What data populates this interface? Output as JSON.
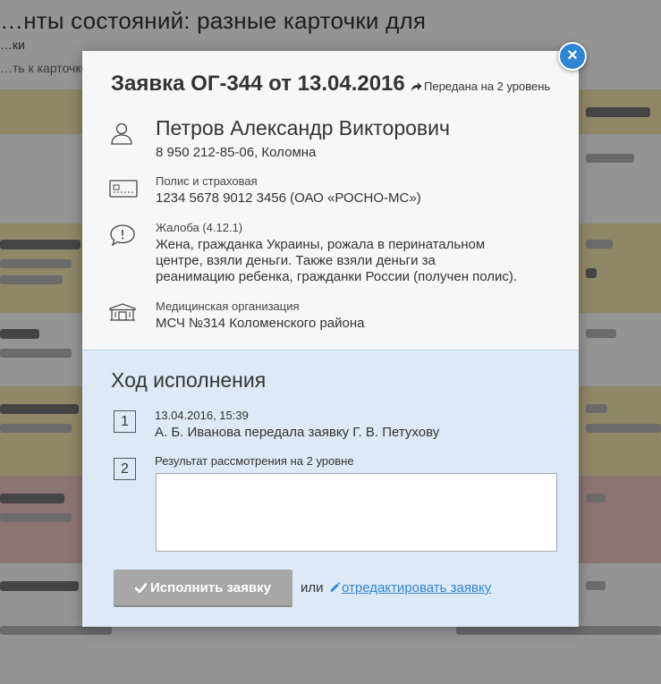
{
  "background": {
    "title": "…нты состояний: разные карточки для",
    "subtitle": "…ки",
    "subtitle2": "…ть к карточке"
  },
  "modal": {
    "close_label": "×",
    "title": "Заявка ОГ-344 от 13.04.2016",
    "status": "Передана на 2 уровень",
    "person": {
      "name": "Петров Александр Викторович",
      "contact": "8 950 212-85-06, Коломна"
    },
    "policy": {
      "label": "Полис и страховая",
      "value": "1234 5678 9012 3456 (ОАО «РОСНО-МС»)"
    },
    "complaint": {
      "label": "Жалоба (4.12.1)",
      "lines": [
        "Жена, гражданка Украины, рожала в перинатальном",
        "центре, взяли деньги. Также взяли деньги за",
        "реанимацию ребенка, гражданки России (получен полис)."
      ]
    },
    "organization": {
      "label": "Медицинская организация",
      "value": "МСЧ №314 Коломенского района"
    },
    "progress": {
      "title": "Ход исполнения",
      "steps": [
        {
          "number": "1",
          "date": "13.04.2016, 15:39",
          "text": "А. Б. Иванова передала заявку Г. В. Петухову"
        },
        {
          "number": "2",
          "label": "Результат рассмотрения на 2 уровне",
          "value": ""
        }
      ]
    },
    "actions": {
      "submit_label": "Исполнить заявку",
      "or_label": "или",
      "edit_label": "отредактировать заявку"
    }
  },
  "colors": {
    "accent": "#2f86d4",
    "panel_light": "#f7f7f7",
    "panel_blue": "#dde9f6",
    "button_disabled": "#a7a7a7"
  },
  "icons": {
    "status": "share-arrow-icon",
    "person": "person-icon",
    "policy": "card-icon",
    "complaint": "speech-bubble-icon",
    "organization": "building-icon",
    "submit": "check-icon",
    "edit": "pencil-icon",
    "close": "close-icon"
  }
}
